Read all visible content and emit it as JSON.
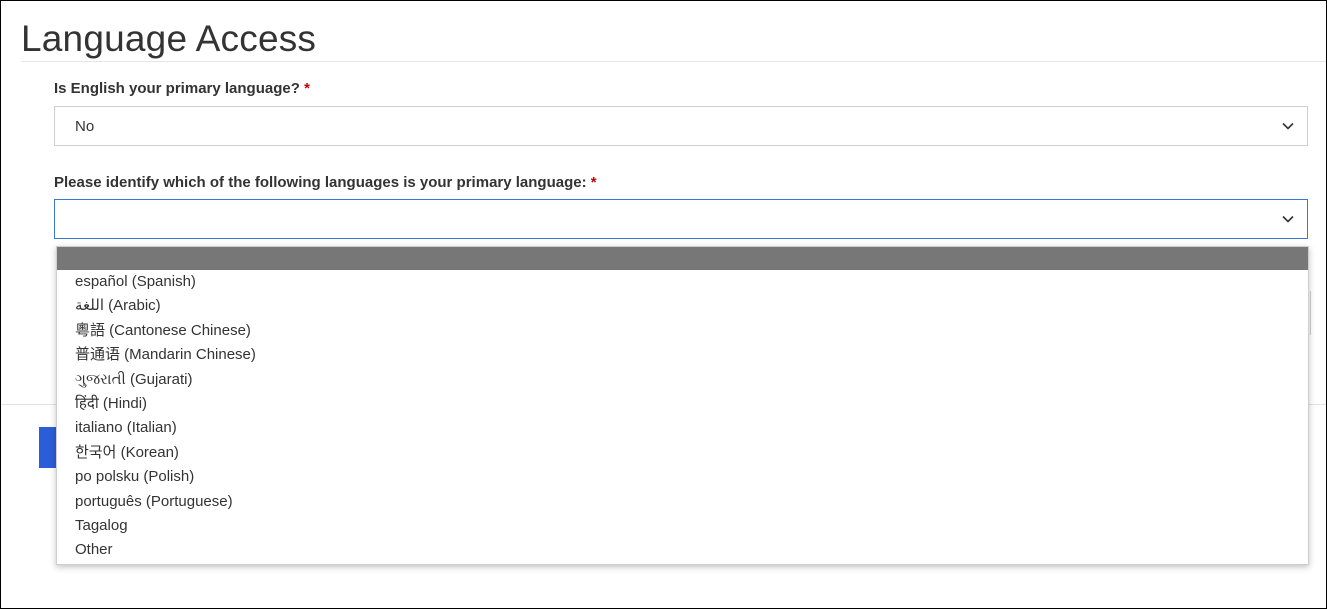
{
  "page": {
    "title": "Language Access"
  },
  "questions": {
    "primary_english": {
      "label": "Is English your primary language?",
      "required_mark": "*",
      "value": "No"
    },
    "primary_language": {
      "label": "Please identify which of the following languages is your primary language:",
      "required_mark": "*",
      "value": ""
    }
  },
  "dropdown": {
    "highlighted_index": 0,
    "options": [
      "",
      "español (Spanish)",
      "اللغة (Arabic)",
      "粵語 (Cantonese Chinese)",
      "普通语 (Mandarin Chinese)",
      "ગુજરાતી (Gujarati)",
      "हिंदी (Hindi)",
      "italiano (Italian)",
      "한국어 (Korean)",
      "po polsku (Polish)",
      "português (Portuguese)",
      "Tagalog",
      "Other"
    ]
  },
  "colors": {
    "focus_border": "#3a78d8",
    "required": "#c00000",
    "highlight": "#777777",
    "button": "#2c5dd9"
  }
}
